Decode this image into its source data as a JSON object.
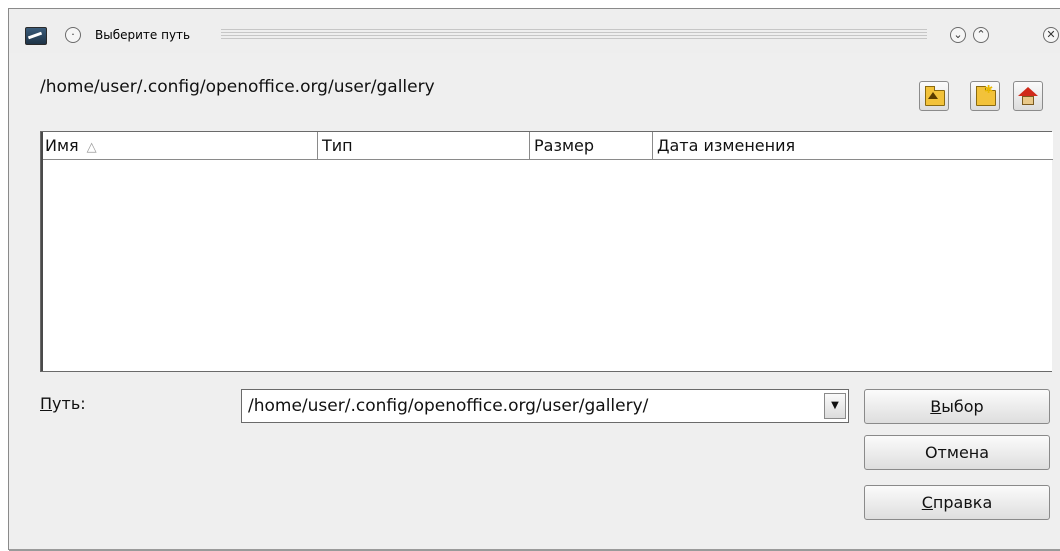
{
  "window": {
    "title": "Выберите путь"
  },
  "titlebar": {
    "menu_glyph": "·",
    "minimize_glyph": "⌄",
    "maximize_glyph": "⌃",
    "close_glyph": "✕"
  },
  "header": {
    "current_path": "/home/user/.config/openoffice.org/user/gallery"
  },
  "toolbar": {
    "up_icon": "folder-up-icon",
    "new_folder_icon": "new-folder-icon",
    "home_icon": "home-icon"
  },
  "filelist": {
    "columns": [
      {
        "label": "Имя",
        "sorted": true
      },
      {
        "label": "Тип"
      },
      {
        "label": "Размер"
      },
      {
        "label": "Дата изменения"
      }
    ],
    "sort_glyph": "△",
    "rows": []
  },
  "path": {
    "label_underlined": "П",
    "label_rest": "уть:",
    "value": "/home/user/.config/openoffice.org/user/gallery/",
    "dropdown_glyph": "▼"
  },
  "buttons": {
    "select_underlined": "В",
    "select_rest": "ыбор",
    "cancel": "Отмена",
    "help_underlined": "С",
    "help_rest": "правка"
  }
}
